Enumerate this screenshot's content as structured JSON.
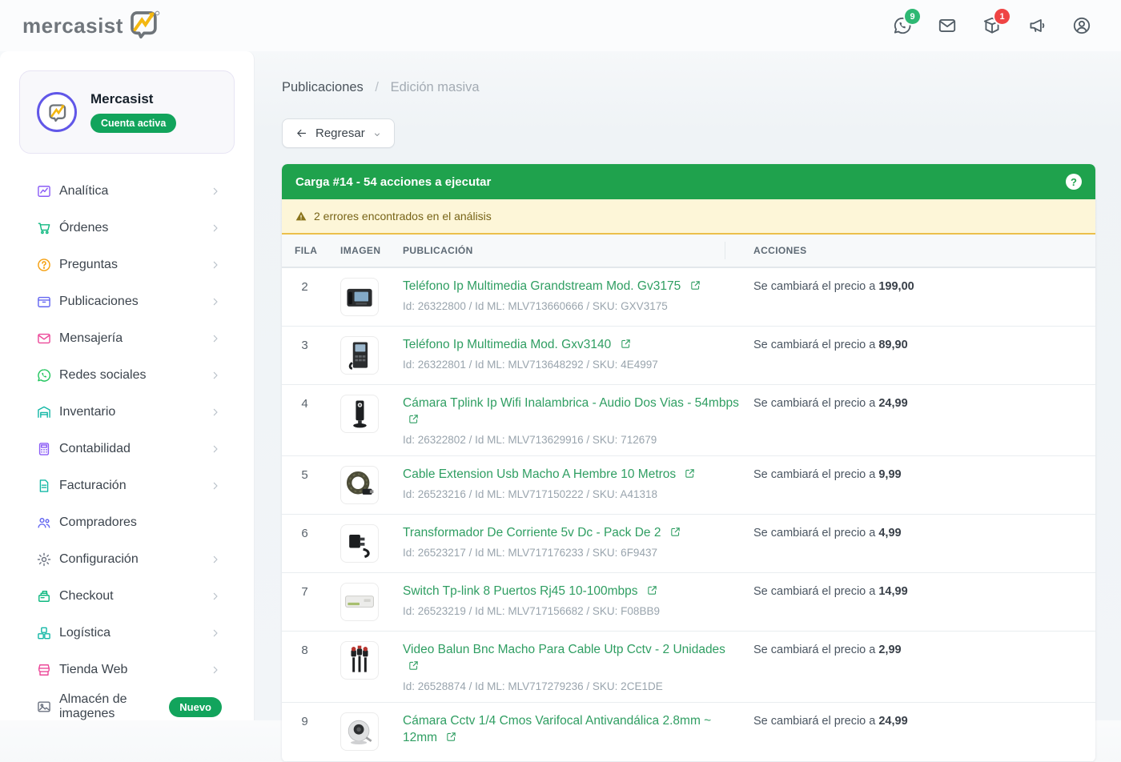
{
  "brand": {
    "logo_text": "mercasist"
  },
  "header": {
    "icons": [
      {
        "name": "whatsapp-icon",
        "icon": "whatsapp",
        "badge": "9",
        "badge_color": "#2eb873"
      },
      {
        "name": "mail-icon",
        "icon": "mail",
        "badge": "",
        "badge_color": ""
      },
      {
        "name": "package-icon",
        "icon": "package",
        "badge": "1",
        "badge_color": "#ef4444"
      },
      {
        "name": "megaphone-icon",
        "icon": "megaphone",
        "badge": "",
        "badge_color": ""
      },
      {
        "name": "profile-icon",
        "icon": "user",
        "badge": "",
        "badge_color": ""
      }
    ]
  },
  "sidebar": {
    "account": {
      "name": "Mercasist",
      "status_badge": "Cuenta activa"
    },
    "items": [
      {
        "label": "Analítica",
        "icon": "chart",
        "color": "#8b5cf6",
        "chevron": true,
        "badge": ""
      },
      {
        "label": "Órdenes",
        "icon": "cart",
        "color": "#10b981",
        "chevron": true,
        "badge": ""
      },
      {
        "label": "Preguntas",
        "icon": "help",
        "color": "#f59e0b",
        "chevron": true,
        "badge": ""
      },
      {
        "label": "Publicaciones",
        "icon": "box",
        "color": "#6366f1",
        "chevron": true,
        "badge": ""
      },
      {
        "label": "Mensajería",
        "icon": "mail",
        "color": "#ec4899",
        "chevron": true,
        "badge": ""
      },
      {
        "label": "Redes sociales",
        "icon": "whatsapp",
        "color": "#22c55e",
        "chevron": true,
        "badge": ""
      },
      {
        "label": "Inventario",
        "icon": "warehouse",
        "color": "#14b8a6",
        "chevron": true,
        "badge": ""
      },
      {
        "label": "Contabilidad",
        "icon": "calculator",
        "color": "#8b5cf6",
        "chevron": true,
        "badge": ""
      },
      {
        "label": "Facturación",
        "icon": "invoice",
        "color": "#14b8a6",
        "chevron": true,
        "badge": ""
      },
      {
        "label": "Compradores",
        "icon": "people",
        "color": "#6366f1",
        "chevron": false,
        "badge": ""
      },
      {
        "label": "Configuración",
        "icon": "gear",
        "color": "#6b7280",
        "chevron": true,
        "badge": ""
      },
      {
        "label": "Checkout",
        "icon": "register",
        "color": "#10b981",
        "chevron": true,
        "badge": ""
      },
      {
        "label": "Logística",
        "icon": "logistics",
        "color": "#14b8a6",
        "chevron": true,
        "badge": ""
      },
      {
        "label": "Tienda Web",
        "icon": "store",
        "color": "#ec4899",
        "chevron": true,
        "badge": ""
      },
      {
        "label": "Almacén de imagenes",
        "icon": "image",
        "color": "#6b7280",
        "chevron": false,
        "badge": "Nuevo"
      }
    ]
  },
  "main": {
    "breadcrumb": {
      "parent": "Publicaciones",
      "separator": "/",
      "current": "Edición masiva"
    },
    "back_button_label": "Regresar",
    "panel": {
      "title": "Carga #14 - 54 acciones a ejecutar",
      "help_glyph": "?",
      "warning": "2 errores encontrados en el análisis"
    },
    "table": {
      "headers": [
        "FILA",
        "IMAGEN",
        "PUBLICACIÓN",
        "ACCIONES"
      ],
      "action_prefix": "Se cambiará el precio a",
      "rows": [
        {
          "fila": "2",
          "title": "Teléfono Ip Multimedia Grandstream Mod. Gv3175",
          "meta": "Id: 26322800 / Id ML: MLV713660666 / SKU: GXV3175",
          "price": "199,00",
          "thumb": "desk-phone"
        },
        {
          "fila": "3",
          "title": "Teléfono Ip Multimedia Mod. Gxv3140",
          "meta": "Id: 26322801 / Id ML: MLV713648292 / SKU: 4E4997",
          "price": "89,90",
          "thumb": "ip-phone"
        },
        {
          "fila": "4",
          "title": "Cámara Tplink Ip Wifi Inalambrica - Audio Dos Vias - 54mbps",
          "meta": "Id: 26322802 / Id ML: MLV713629916 / SKU: 712679",
          "price": "24,99",
          "thumb": "camera-stand"
        },
        {
          "fila": "5",
          "title": "Cable Extension Usb Macho A Hembre 10 Metros",
          "meta": "Id: 26523216 / Id ML: MLV717150222 / SKU: A41318",
          "price": "9,99",
          "thumb": "cable-coil"
        },
        {
          "fila": "6",
          "title": "Transformador De Corriente 5v Dc - Pack De 2",
          "meta": "Id: 26523217 / Id ML: MLV717176233 / SKU: 6F9437",
          "price": "4,99",
          "thumb": "adapter"
        },
        {
          "fila": "7",
          "title": "Switch Tp-link 8 Puertos Rj45 10-100mbps",
          "meta": "Id: 26523219 / Id ML: MLV717156682 / SKU: F08BB9",
          "price": "14,99",
          "thumb": "switch"
        },
        {
          "fila": "8",
          "title": "Video Balun Bnc Macho Para Cable Utp Cctv - 2 Unidades",
          "meta": "Id: 26528874 / Id ML: MLV717279236 / SKU: 2CE1DE",
          "price": "2,99",
          "thumb": "balun"
        },
        {
          "fila": "9",
          "title": "Cámara Cctv 1/4 Cmos Varifocal Antivandálica 2.8mm ~ 12mm",
          "meta": "",
          "price": "24,99",
          "thumb": "dome-cam"
        }
      ]
    }
  }
}
